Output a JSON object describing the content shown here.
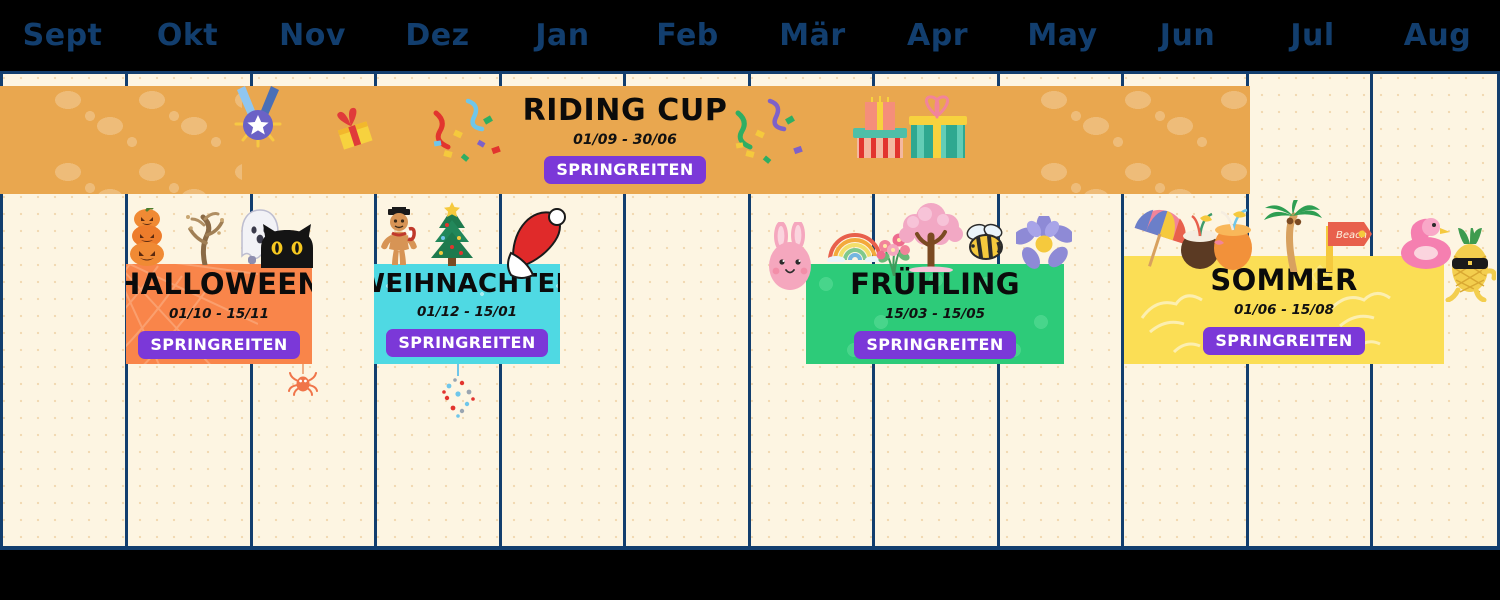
{
  "header": {
    "months": [
      "Sept",
      "Okt",
      "Nov",
      "Dez",
      "Jan",
      "Feb",
      "Mär",
      "Apr",
      "May",
      "Jun",
      "Jul",
      "Aug"
    ],
    "month_color": "#123E6E"
  },
  "colors": {
    "background": "#FDF5E2",
    "grid_line": "#123E6E",
    "badge": "#7B38D8",
    "badge_text": "#FFFFFF",
    "banner_riding_cup": "#E9A74F",
    "card_halloween": "#F9854A",
    "card_weihnachten": "#4FD9E3",
    "card_fruehling": "#2DCB79",
    "card_sommer": "#FBDE55",
    "outer": "#000000"
  },
  "banner": {
    "title": "RIDING CUP",
    "dates": "01/09 - 30/06",
    "badge": "SPRINGREITEN",
    "decor": [
      "trophy-star-pattern-icon",
      "medal-icon",
      "gift-small-icon",
      "confetti-icon",
      "confetti-icon",
      "gift-stack-icon",
      "trophy-star-pattern-icon"
    ]
  },
  "events": [
    {
      "id": "halloween",
      "title": "HALLOWEEN",
      "dates": "01/10 - 15/11",
      "badge": "SPRINGREITEN",
      "decor": [
        "pumpkin-stack-icon",
        "dead-tree-icon",
        "ghost-icon",
        "black-cat-icon",
        "spider-icon",
        "spider-web-icon"
      ]
    },
    {
      "id": "weihnachten",
      "title": "WEIHNACHTEN",
      "dates": "01/12 - 15/01",
      "badge": "SPRINGREITEN",
      "decor": [
        "gingerbread-man-icon",
        "christmas-tree-icon",
        "santa-hat-icon",
        "christmas-bauble-icon"
      ]
    },
    {
      "id": "fruehling",
      "title": "FRÜHLING",
      "dates": "15/03 - 15/05",
      "badge": "SPRINGREITEN",
      "decor": [
        "bunny-icon",
        "rainbow-icon",
        "flower-bouquet-icon",
        "cherry-blossom-tree-icon",
        "bee-icon",
        "purple-flower-icon"
      ]
    },
    {
      "id": "sommer",
      "title": "SOMMER",
      "dates": "01/06 - 15/08",
      "badge": "SPRINGREITEN",
      "decor": [
        "beach-umbrella-icon",
        "tropical-drinks-icon",
        "palm-tree-icon",
        "beach-signpost-icon",
        "flamingo-float-icon",
        "pineapple-sunglasses-icon"
      ]
    }
  ]
}
